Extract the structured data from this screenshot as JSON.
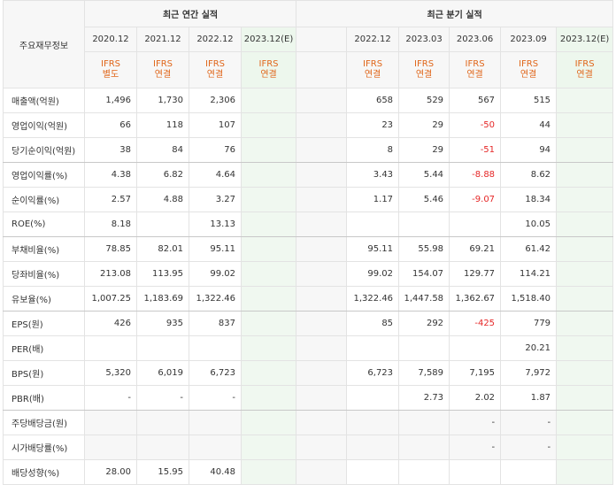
{
  "header": {
    "corner_label": "주요재무정보",
    "annual_title": "최근 연간 실적",
    "quarter_title": "최근 분기 실적",
    "annual_dates": [
      "2020.12",
      "2021.12",
      "2022.12",
      "2023.12(E)"
    ],
    "quarter_dates": [
      "2022.12",
      "2023.03",
      "2023.06",
      "2023.09",
      "2023.12(E)"
    ],
    "annual_acc": [
      [
        "IFRS",
        "별도"
      ],
      [
        "IFRS",
        "연결"
      ],
      [
        "IFRS",
        "연결"
      ],
      [
        "IFRS",
        "연결"
      ]
    ],
    "quarter_acc": [
      [
        "IFRS",
        "연결"
      ],
      [
        "IFRS",
        "연결"
      ],
      [
        "IFRS",
        "연결"
      ],
      [
        "IFRS",
        "연결"
      ],
      [
        "IFRS",
        "연결"
      ]
    ]
  },
  "colors": {
    "accent": "#e0661a",
    "negative": "#e52727",
    "estimate_bg": "#f0f8f0"
  },
  "rows": [
    {
      "label": "매출액(억원)",
      "annual": [
        "1,496",
        "1,730",
        "2,306",
        ""
      ],
      "quarter": [
        "658",
        "529",
        "567",
        "515",
        ""
      ]
    },
    {
      "label": "영업이익(억원)",
      "annual": [
        "66",
        "118",
        "107",
        ""
      ],
      "quarter": [
        "23",
        "29",
        "-50",
        "44",
        ""
      ]
    },
    {
      "label": "당기순이익(억원)",
      "annual": [
        "38",
        "84",
        "76",
        ""
      ],
      "quarter": [
        "8",
        "29",
        "-51",
        "94",
        ""
      ]
    },
    {
      "label": "영업이익률(%)",
      "annual": [
        "4.38",
        "6.82",
        "4.64",
        ""
      ],
      "quarter": [
        "3.43",
        "5.44",
        "-8.88",
        "8.62",
        ""
      ]
    },
    {
      "label": "순이익률(%)",
      "annual": [
        "2.57",
        "4.88",
        "3.27",
        ""
      ],
      "quarter": [
        "1.17",
        "5.46",
        "-9.07",
        "18.34",
        ""
      ]
    },
    {
      "label": "ROE(%)",
      "annual": [
        "8.18",
        "",
        "13.13",
        ""
      ],
      "quarter": [
        "",
        "",
        "",
        "10.05",
        ""
      ]
    },
    {
      "label": "부채비율(%)",
      "annual": [
        "78.85",
        "82.01",
        "95.11",
        ""
      ],
      "quarter": [
        "95.11",
        "55.98",
        "69.21",
        "61.42",
        ""
      ]
    },
    {
      "label": "당좌비율(%)",
      "annual": [
        "213.08",
        "113.95",
        "99.02",
        ""
      ],
      "quarter": [
        "99.02",
        "154.07",
        "129.77",
        "114.21",
        ""
      ]
    },
    {
      "label": "유보율(%)",
      "annual": [
        "1,007.25",
        "1,183.69",
        "1,322.46",
        ""
      ],
      "quarter": [
        "1,322.46",
        "1,447.58",
        "1,362.67",
        "1,518.40",
        ""
      ]
    },
    {
      "label": "EPS(원)",
      "annual": [
        "426",
        "935",
        "837",
        ""
      ],
      "quarter": [
        "85",
        "292",
        "-425",
        "779",
        ""
      ]
    },
    {
      "label": "PER(배)",
      "annual": [
        "",
        "",
        "",
        ""
      ],
      "quarter": [
        "",
        "",
        "",
        "20.21",
        ""
      ]
    },
    {
      "label": "BPS(원)",
      "annual": [
        "5,320",
        "6,019",
        "6,723",
        ""
      ],
      "quarter": [
        "6,723",
        "7,589",
        "7,195",
        "7,972",
        ""
      ]
    },
    {
      "label": "PBR(배)",
      "annual": [
        "-",
        "-",
        "-",
        ""
      ],
      "quarter": [
        "",
        "2.73",
        "2.02",
        "1.87",
        ""
      ]
    },
    {
      "label": "주당배당금(원)",
      "annual": [
        "",
        "",
        "",
        ""
      ],
      "quarter": [
        "",
        "",
        "-",
        "-",
        ""
      ]
    },
    {
      "label": "시가배당률(%)",
      "annual": [
        "",
        "",
        "",
        ""
      ],
      "quarter": [
        "",
        "",
        "-",
        "-",
        ""
      ]
    },
    {
      "label": "배당성향(%)",
      "annual": [
        "28.00",
        "15.95",
        "40.48",
        ""
      ],
      "quarter": [
        "",
        "",
        "",
        "",
        ""
      ]
    }
  ]
}
